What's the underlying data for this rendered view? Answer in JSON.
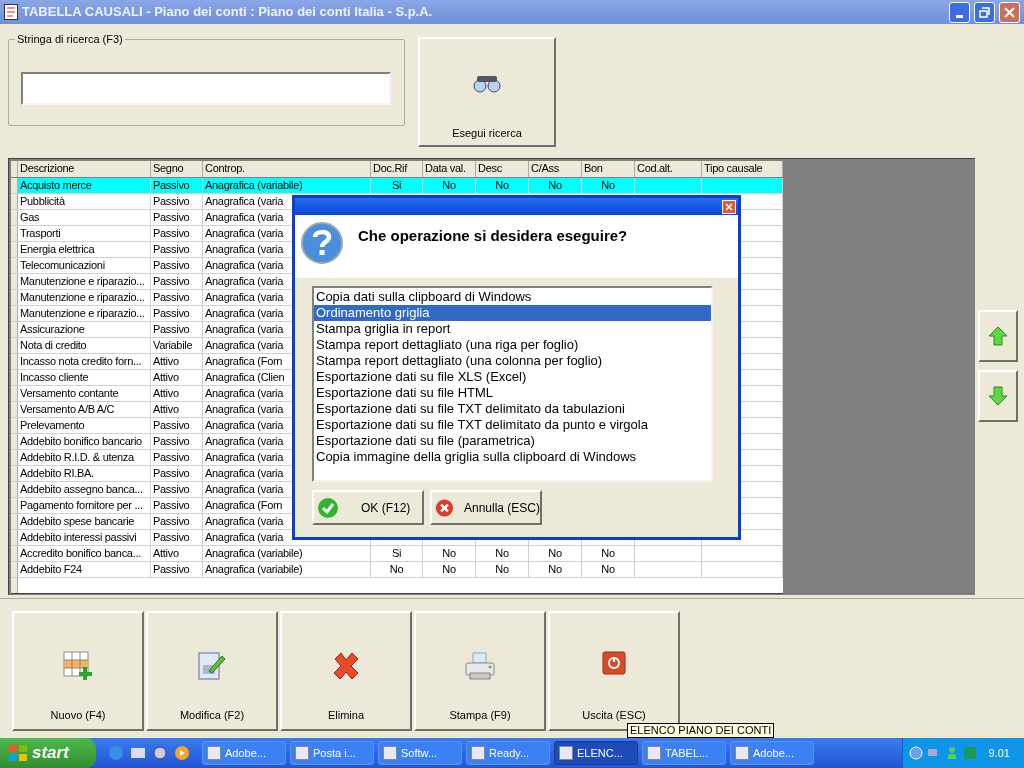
{
  "window": {
    "title": "TABELLA CAUSALI - Piano dei conti : Piano dei conti Italia - S.p.A."
  },
  "search": {
    "label": "Stringa di ricerca (F3)",
    "button": "Esegui ricerca"
  },
  "table": {
    "columns": [
      "Descrizione",
      "Segno",
      "Controp.",
      "Doc.Rif",
      "Data val.",
      "Desc",
      "C/Ass",
      "Bon",
      "Cod.alt.",
      "Tipo causale"
    ],
    "rows": [
      {
        "selected": true,
        "cells": [
          "Acquisto merce",
          "Passivo",
          "Anagrafica (variabile)",
          "Si",
          "No",
          "No",
          "No",
          "No"
        ]
      },
      {
        "selected": false,
        "cells": [
          "Pubblicità",
          "Passivo",
          "Anagrafica (varia"
        ]
      },
      {
        "selected": false,
        "cells": [
          "Gas",
          "Passivo",
          "Anagrafica (varia"
        ]
      },
      {
        "selected": false,
        "cells": [
          "Trasporti",
          "Passivo",
          "Anagrafica (varia"
        ]
      },
      {
        "selected": false,
        "cells": [
          "Energia elettrica",
          "Passivo",
          "Anagrafica (varia"
        ]
      },
      {
        "selected": false,
        "cells": [
          "Telecomunicazioni",
          "Passivo",
          "Anagrafica (varia"
        ]
      },
      {
        "selected": false,
        "cells": [
          "Manutenzione e riparazio...",
          "Passivo",
          "Anagrafica (varia"
        ]
      },
      {
        "selected": false,
        "cells": [
          "Manutenzione e riparazio...",
          "Passivo",
          "Anagrafica (varia"
        ]
      },
      {
        "selected": false,
        "cells": [
          "Manutenzione e riparazio...",
          "Passivo",
          "Anagrafica (varia"
        ]
      },
      {
        "selected": false,
        "cells": [
          "Assicurazione",
          "Passivo",
          "Anagrafica (varia"
        ]
      },
      {
        "selected": false,
        "cells": [
          "Nota di credito",
          "Variabile",
          "Anagrafica (varia"
        ]
      },
      {
        "selected": false,
        "cells": [
          "Incasso nota credito forn...",
          "Attivo",
          "Anagrafica (Forn"
        ]
      },
      {
        "selected": false,
        "cells": [
          "Incasso cliente",
          "Attivo",
          "Anagrafica (Clien"
        ]
      },
      {
        "selected": false,
        "cells": [
          "Versamento contante",
          "Attivo",
          "Anagrafica (varia"
        ]
      },
      {
        "selected": false,
        "cells": [
          "Versamento A/B A/C",
          "Attivo",
          "Anagrafica (varia"
        ]
      },
      {
        "selected": false,
        "cells": [
          "Prelevamento",
          "Passivo",
          "Anagrafica (varia"
        ]
      },
      {
        "selected": false,
        "cells": [
          "Addebito bonifico bancario",
          "Passivo",
          "Anagrafica (varia"
        ]
      },
      {
        "selected": false,
        "cells": [
          "Addebito R.I.D. &  utenza",
          "Passivo",
          "Anagrafica (varia"
        ]
      },
      {
        "selected": false,
        "cells": [
          "Addebito RI.BA.",
          "Passivo",
          "Anagrafica (varia"
        ]
      },
      {
        "selected": false,
        "cells": [
          "Addebito assegno banca...",
          "Passivo",
          "Anagrafica (varia"
        ]
      },
      {
        "selected": false,
        "cells": [
          "Pagamento fornitore per ...",
          "Passivo",
          "Anagrafica (Forn"
        ]
      },
      {
        "selected": false,
        "cells": [
          "Addebito spese bancarie",
          "Passivo",
          "Anagrafica (varia"
        ]
      },
      {
        "selected": false,
        "cells": [
          "Addebito interessi passivi",
          "Passivo",
          "Anagrafica (varia"
        ]
      },
      {
        "selected": false,
        "cells": [
          "Accredito bonifico banca...",
          "Attivo",
          "Anagrafica (variabile)",
          "Si",
          "No",
          "No",
          "No",
          "No"
        ]
      },
      {
        "selected": false,
        "cells": [
          "Addebito F24",
          "Passivo",
          "Anagrafica (variabile)",
          "No",
          "No",
          "No",
          "No",
          "No"
        ]
      }
    ]
  },
  "buttons": [
    "Nuovo (F4)",
    "Modifica (F2)",
    "Elimina",
    "Stampa (F9)",
    "Uscita (ESC)"
  ],
  "tooltip": "ELENCO PIANO DEI CONTI",
  "dialog": {
    "question": "Che operazione si desidera eseguire?",
    "options": [
      {
        "label": "Copia dati sulla clipboard di Windows",
        "selected": false
      },
      {
        "label": "Ordinamento griglia",
        "selected": true
      },
      {
        "label": "Stampa griglia in report",
        "selected": false
      },
      {
        "label": "Stampa report dettagliato (una riga per foglio)",
        "selected": false
      },
      {
        "label": "Stampa report dettagliato (una colonna per foglio)",
        "selected": false
      },
      {
        "label": "Esportazione dati su file XLS (Excel)",
        "selected": false
      },
      {
        "label": "Esportazione dati su file HTML",
        "selected": false
      },
      {
        "label": "Esportazione dati su file TXT delimitato da tabulazioni",
        "selected": false
      },
      {
        "label": "Esportazione dati su file TXT delimitato da punto e virgola",
        "selected": false
      },
      {
        "label": "Esportazione dati su file (parametrica)",
        "selected": false
      },
      {
        "label": "Copia immagine della griglia sulla clipboard di Windows",
        "selected": false
      }
    ],
    "ok": "OK (F12)",
    "cancel": "Annulla (ESC)"
  },
  "taskbar": {
    "start": "start",
    "tasks": [
      {
        "label": "Adobe...",
        "selected": false
      },
      {
        "label": "Posta i...",
        "selected": false
      },
      {
        "label": "Softw...",
        "selected": false
      },
      {
        "label": "Ready...",
        "selected": false
      },
      {
        "label": "ELENC...",
        "selected": true
      },
      {
        "label": "TABEL...",
        "selected": false
      },
      {
        "label": "Adobe...",
        "selected": false
      }
    ],
    "clock": "9.01"
  }
}
